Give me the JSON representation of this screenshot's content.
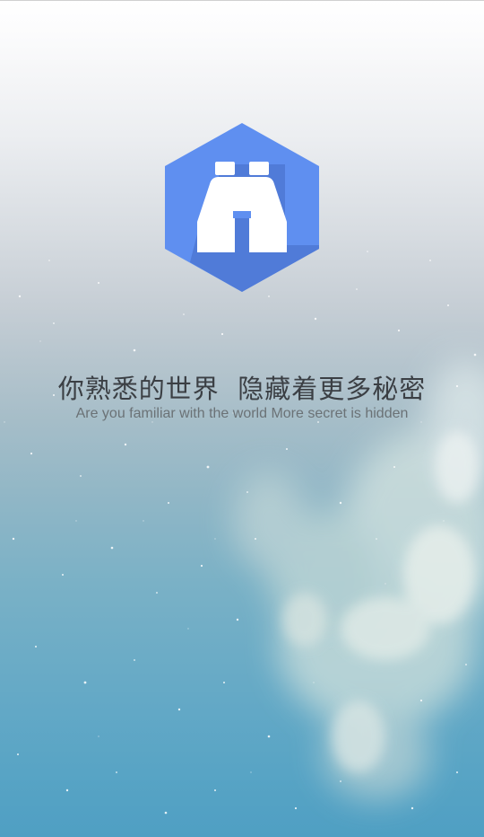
{
  "splash": {
    "logo_icon": "binoculars-icon",
    "logo_color": "#5f8ff0",
    "tagline_cn": "你熟悉的世界  隐藏着更多秘密",
    "tagline_en": "Are you familiar with the world More secret is hidden"
  }
}
